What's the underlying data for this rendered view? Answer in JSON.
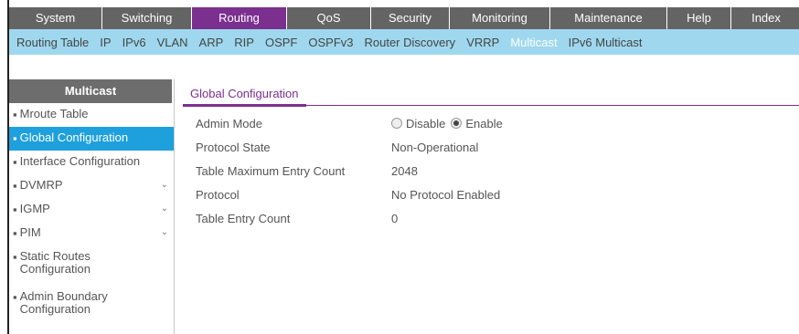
{
  "top_nav": [
    "System",
    "Switching",
    "Routing",
    "QoS",
    "Security",
    "Monitoring",
    "Maintenance",
    "Help",
    "Index"
  ],
  "top_nav_active": "Routing",
  "sub_nav": [
    "Routing Table",
    "IP",
    "IPv6",
    "VLAN",
    "ARP",
    "RIP",
    "OSPF",
    "OSPFv3",
    "Router Discovery",
    "VRRP",
    "Multicast",
    "IPv6 Multicast"
  ],
  "sub_nav_active": "Multicast",
  "sidebar": {
    "title": "Multicast",
    "items": [
      {
        "label": "Mroute Table"
      },
      {
        "label": "Global Configuration"
      },
      {
        "label": "Interface Configuration"
      },
      {
        "label": "DVMRP",
        "expand": "chevron-down"
      },
      {
        "label": "IGMP",
        "expand": "chevron-down"
      },
      {
        "label": "PIM",
        "expand": "chevron-down"
      },
      {
        "label": "Static Routes Configuration"
      },
      {
        "label": "Admin Boundary Configuration"
      }
    ],
    "active": "Global Configuration"
  },
  "content": {
    "tab": "Global Configuration",
    "admin_mode": {
      "label": "Admin Mode",
      "options": [
        "Disable",
        "Enable"
      ],
      "selected": "Enable"
    },
    "protocol_state": {
      "label": "Protocol State",
      "value": "Non-Operational"
    },
    "table_max": {
      "label": "Table Maximum Entry Count",
      "value": "2048"
    },
    "protocol": {
      "label": "Protocol",
      "value": "No Protocol Enabled"
    },
    "table_entry": {
      "label": "Table Entry Count",
      "value": "0"
    }
  },
  "colors": {
    "accent": "#7b2f8f",
    "nav_gray": "#646464",
    "subnav_blue": "#9fd8ee",
    "sidebar_active": "#1ea0dc"
  }
}
